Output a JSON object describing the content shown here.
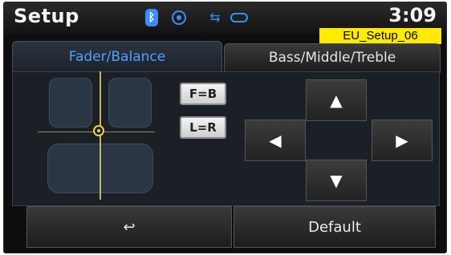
{
  "status": {
    "title": "Setup",
    "time": "3:09",
    "icons": [
      "bluetooth-icon",
      "target-icon",
      "usb-icon",
      "disc-icon"
    ]
  },
  "overlay_label": "EU_Setup_06",
  "tabs": [
    {
      "label": "Fader/Balance",
      "active": true
    },
    {
      "label": "Bass/Middle/Treble",
      "active": false
    }
  ],
  "controls": {
    "fader_reset": "F=B",
    "balance_reset": "L=R",
    "up": "▲",
    "down": "▼",
    "left": "◀",
    "right": "▶"
  },
  "bottom": {
    "back_icon": "↩",
    "default_label": "Default"
  },
  "colors": {
    "accent_blue": "#3c8dff",
    "label_yellow": "#ffeb00",
    "crosshair_gold": "#f2d04a"
  }
}
